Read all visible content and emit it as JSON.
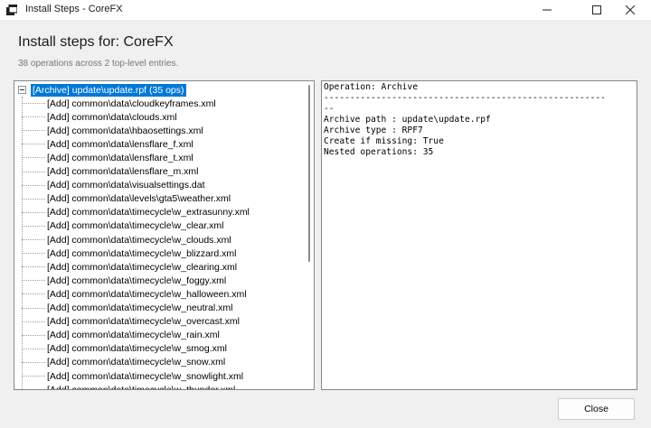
{
  "window": {
    "title": "Install Steps - CoreFX"
  },
  "header": {
    "title": "Install steps for: CoreFX",
    "subtitle": "38 operations across 2 top-level entries."
  },
  "tree": {
    "root_label": "[Archive] update\\update.rpf  (35 ops)",
    "items": [
      "[Add] common\\data\\cloudkeyframes.xml",
      "[Add] common\\data\\clouds.xml",
      "[Add] common\\data\\hbaosettings.xml",
      "[Add] common\\data\\lensflare_f.xml",
      "[Add] common\\data\\lensflare_t.xml",
      "[Add] common\\data\\lensflare_m.xml",
      "[Add] common\\data\\visualsettings.dat",
      "[Add] common\\data\\levels\\gta5\\weather.xml",
      "[Add] common\\data\\timecycle\\w_extrasunny.xml",
      "[Add] common\\data\\timecycle\\w_clear.xml",
      "[Add] common\\data\\timecycle\\w_clouds.xml",
      "[Add] common\\data\\timecycle\\w_blizzard.xml",
      "[Add] common\\data\\timecycle\\w_clearing.xml",
      "[Add] common\\data\\timecycle\\w_foggy.xml",
      "[Add] common\\data\\timecycle\\w_halloween.xml",
      "[Add] common\\data\\timecycle\\w_neutral.xml",
      "[Add] common\\data\\timecycle\\w_overcast.xml",
      "[Add] common\\data\\timecycle\\w_rain.xml",
      "[Add] common\\data\\timecycle\\w_smog.xml",
      "[Add] common\\data\\timecycle\\w_snow.xml",
      "[Add] common\\data\\timecycle\\w_snowlight.xml",
      "[Add] common\\data\\timecycle\\w_thunder.xml"
    ]
  },
  "details": {
    "lines": [
      "Operation: Archive",
      "------------------------------------------------------",
      "--",
      "Archive path : update\\update.rpf",
      "Archive type : RPF7",
      "Create if missing: True",
      "Nested operations: 35"
    ]
  },
  "footer": {
    "close_label": "Close"
  },
  "icons": {
    "app": "app-window-icon",
    "minimize": "minimize-icon",
    "maximize": "maximize-icon",
    "close": "close-icon"
  },
  "colors": {
    "selection": "#0078d7",
    "panel_border": "#828790"
  }
}
